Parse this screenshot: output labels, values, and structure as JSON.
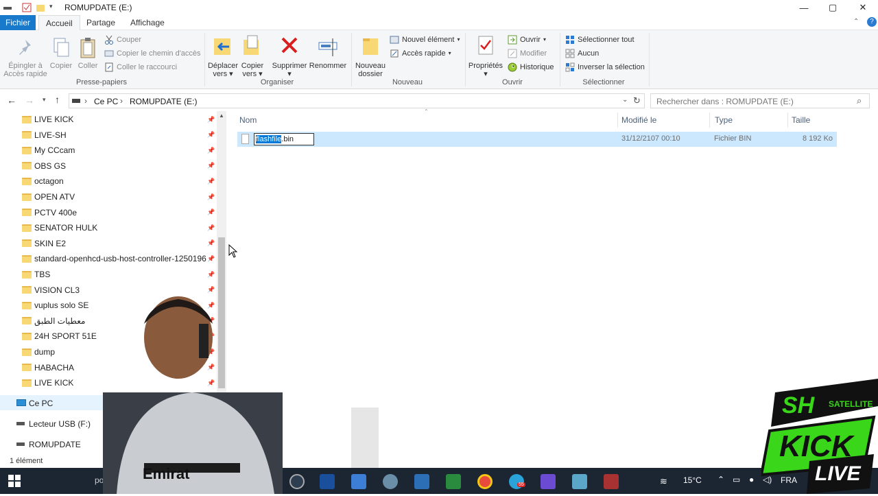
{
  "window": {
    "title": "ROMUPDATE (E:)",
    "controls": {
      "minimize": "—",
      "maximize": "▢",
      "close": "✕"
    }
  },
  "tabs": {
    "file": "Fichier",
    "home": "Accueil",
    "share": "Partage",
    "view": "Affichage"
  },
  "ribbon": {
    "clipboard": {
      "label": "Presse-papiers",
      "pin_line1": "Épingler à",
      "pin_line2": "Accès rapide",
      "copy": "Copier",
      "paste": "Coller",
      "cut": "Couper",
      "copy_path": "Copier le chemin d'accès",
      "paste_shortcut": "Coller le raccourci"
    },
    "organize": {
      "label": "Organiser",
      "move_line1": "Déplacer",
      "move_line2": "vers",
      "copyto_line1": "Copier",
      "copyto_line2": "vers",
      "delete": "Supprimer",
      "rename": "Renommer"
    },
    "new": {
      "label": "Nouveau",
      "new_folder_line1": "Nouveau",
      "new_folder_line2": "dossier",
      "new_item": "Nouvel élément",
      "easy_access": "Accès rapide"
    },
    "open": {
      "label": "Ouvrir",
      "properties": "Propriétés",
      "open": "Ouvrir",
      "edit": "Modifier",
      "history": "Historique"
    },
    "select": {
      "label": "Sélectionner",
      "select_all": "Sélectionner tout",
      "select_none": "Aucun",
      "invert": "Inverser la sélection"
    }
  },
  "address": {
    "crumb1": "Ce PC",
    "crumb2": "ROMUPDATE (E:)",
    "search_placeholder": "Rechercher dans : ROMUPDATE (E:)"
  },
  "nav": {
    "items": [
      "LIVE KICK",
      "LIVE-SH",
      "My CCcam",
      "OBS GS",
      "octagon",
      "OPEN ATV",
      "PCTV 400e",
      "SENATOR HULK",
      "SKIN E2",
      "standard-openhcd-usb-host-controller-1250196",
      "TBS",
      "VISION CL3",
      "vuplus solo SE",
      "معطيات الطبق",
      "24H SPORT 51E",
      "dump",
      "HABACHA",
      "LIVE KICK"
    ],
    "this_pc": "Ce PC",
    "usb": "Lecteur USB (F:)",
    "romupdate": "ROMUPDATE"
  },
  "columns": {
    "name": "Nom",
    "modified": "Modifié le",
    "type": "Type",
    "size": "Taille"
  },
  "file": {
    "name_selected": "flashfile",
    "name_ext": ".bin",
    "modified": "31/12/2107 00:10",
    "type": "Fichier BIN",
    "size": "8 192 Ko"
  },
  "status": {
    "count": "1 élément"
  },
  "taskbar": {
    "search_text": "pour re",
    "temperature": "15°C",
    "language": "FRA",
    "badge": "55"
  },
  "overlay": {
    "logo_sh": "SH",
    "logo_sat": "SATELLITE",
    "logo_kick": "KICK",
    "logo_live": "LIVE",
    "shirt_text": "Emirat"
  },
  "colors": {
    "accent": "#1979ca",
    "selection": "#cce8ff",
    "folder": "#f8d775",
    "taskbar": "#1c2633",
    "logo_green": "#39d61a"
  }
}
